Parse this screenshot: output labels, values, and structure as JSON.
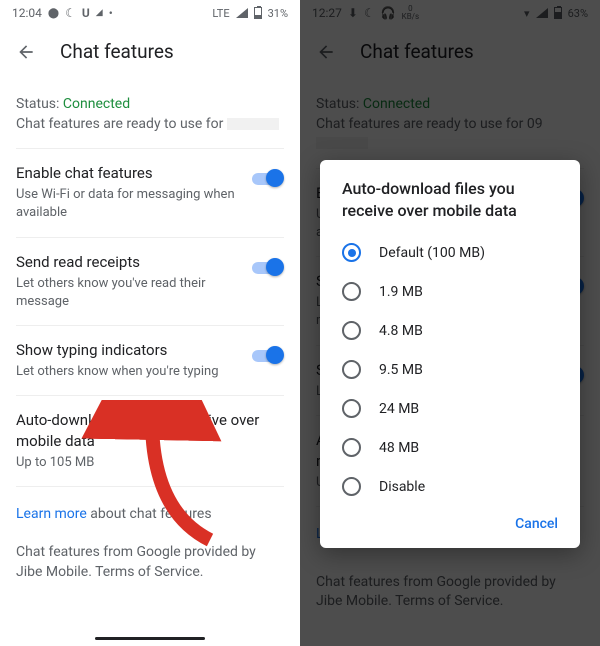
{
  "left": {
    "statusbar": {
      "time": "12:04",
      "network": "LTE",
      "battery": "31%"
    },
    "header": {
      "title": "Chat features"
    },
    "status": {
      "label": "Status:",
      "value": "Connected",
      "desc": "Chat features are ready to use for"
    },
    "settings": [
      {
        "title": "Enable chat features",
        "sub": "Use Wi-Fi or data for messaging when available",
        "on": true
      },
      {
        "title": "Send read receipts",
        "sub": "Let others know you've read their message",
        "on": true
      },
      {
        "title": "Show typing indicators",
        "sub": "Let others know when you're typing",
        "on": true
      },
      {
        "title": "Auto-download files you receive over mobile data",
        "sub": "Up to 105 MB",
        "toggle": false
      }
    ],
    "learn": {
      "link": "Learn more",
      "rest": " about chat features"
    },
    "footer": "Chat features from Google provided by Jibe Mobile. Terms of Service."
  },
  "right": {
    "statusbar": {
      "time": "12:27",
      "speed": "0",
      "speed_unit": "KB/s",
      "battery": "63%"
    },
    "header": {
      "title": "Chat features"
    },
    "status": {
      "label": "Status:",
      "value": "Connected",
      "desc": "Chat features are ready to use for 09"
    },
    "dialog": {
      "title": "Auto-download files you receive over mobile data",
      "options": [
        "Default (100 MB)",
        "1.9 MB",
        "4.8 MB",
        "9.5 MB",
        "24 MB",
        "48 MB",
        "Disable"
      ],
      "selected": 0,
      "cancel": "Cancel"
    }
  }
}
